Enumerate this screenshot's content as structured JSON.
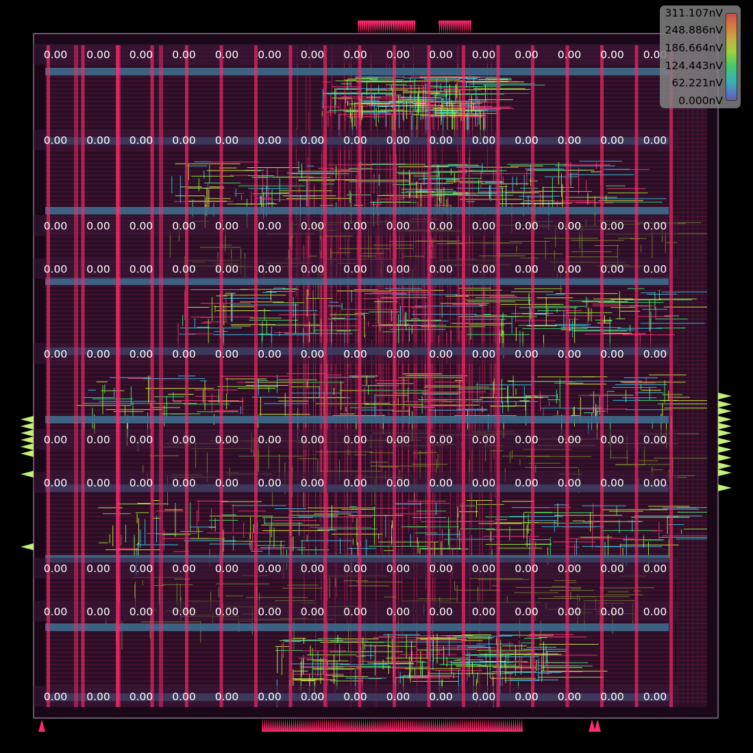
{
  "view": {
    "background": "#000000",
    "die_outline_color": "#8a6a8e",
    "row_band_color": "#3f6a8c",
    "power_rail_color": "#ff2a6d",
    "pin_color": "#c2f07a",
    "wire_colors": [
      "#9bff3c",
      "#3cff7a",
      "#e5ff46",
      "#34d8ff",
      "#ff3a7a"
    ]
  },
  "grid": {
    "rows": 13,
    "cols": 15,
    "cell_values": [
      [
        "0.00",
        "0.00",
        "0.00",
        "0.00",
        "0.00",
        "0.00",
        "0.00",
        "0.00",
        "0.00",
        "0.00",
        "0.00",
        "0.00",
        "0.00",
        "0.00",
        "0.00"
      ],
      [
        "0.00",
        "0.00",
        "0.00",
        "0.00",
        "0.00",
        "0.00",
        "0.00",
        "0.00",
        "0.00",
        "0.00",
        "0.00",
        "0.00",
        "0.00",
        "0.00",
        "0.00"
      ],
      [
        "0.00",
        "0.00",
        "0.00",
        "0.00",
        "0.00",
        "0.00",
        "0.00",
        "0.00",
        "0.00",
        "0.00",
        "0.00",
        "0.00",
        "0.00",
        "0.00",
        "0.00"
      ],
      [
        "0.00",
        "0.00",
        "0.00",
        "0.00",
        "0.00",
        "0.00",
        "0.00",
        "0.00",
        "0.00",
        "0.00",
        "0.00",
        "0.00",
        "0.00",
        "0.00",
        "0.00"
      ],
      [
        "0.00",
        "0.00",
        "0.00",
        "0.00",
        "0.00",
        "0.00",
        "0.00",
        "0.00",
        "0.00",
        "0.00",
        "0.00",
        "0.00",
        "0.00",
        "0.00",
        "0.00"
      ],
      [
        "0.00",
        "0.00",
        "0.00",
        "0.00",
        "0.00",
        "0.00",
        "0.00",
        "0.00",
        "0.00",
        "0.00",
        "0.00",
        "0.00",
        "0.00",
        "0.00",
        "0.00"
      ],
      [
        "0.00",
        "0.00",
        "0.00",
        "0.00",
        "0.00",
        "0.00",
        "0.00",
        "0.00",
        "0.00",
        "0.00",
        "0.00",
        "0.00",
        "0.00",
        "0.00",
        "0.00"
      ],
      [
        "0.00",
        "0.00",
        "0.00",
        "0.00",
        "0.00",
        "0.00",
        "0.00",
        "0.00",
        "0.00",
        "0.00",
        "0.00",
        "0.00",
        "0.00",
        "0.00",
        "0.00"
      ],
      [
        "0.00",
        "0.00",
        "0.00",
        "0.00",
        "0.00",
        "0.00",
        "0.00",
        "0.00",
        "0.00",
        "0.00",
        "0.00",
        "0.00",
        "0.00",
        "0.00",
        "0.00"
      ],
      [
        "0.00",
        "0.00",
        "0.00",
        "0.00",
        "0.00",
        "0.00",
        "0.00",
        "0.00",
        "0.00",
        "0.00",
        "0.00",
        "0.00",
        "0.00",
        "0.00",
        "0.00"
      ]
    ]
  },
  "legend": {
    "values": [
      "311.107nV",
      "248.886nV",
      "186.664nV",
      "124.443nV",
      "62.221nV",
      "0.000nV"
    ],
    "gradient_stops": [
      "#c8504a",
      "#d9793e",
      "#c3b040",
      "#9cd23a",
      "#46c86a",
      "#35b4b4",
      "#5678c8",
      "#6a5a9e"
    ]
  }
}
